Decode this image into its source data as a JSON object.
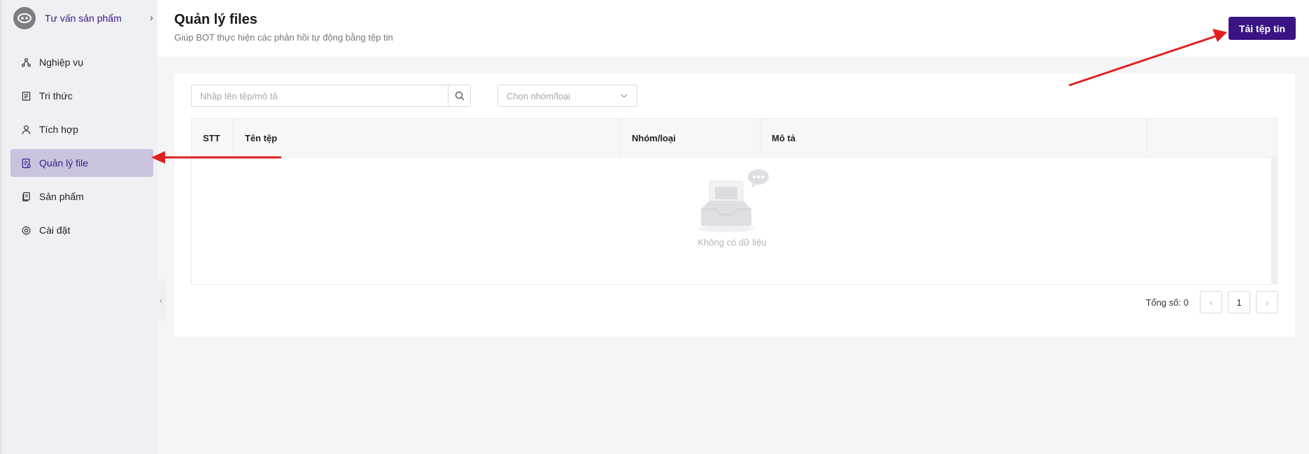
{
  "sidebar": {
    "bot_name": "Tư vấn sản phẩm",
    "items": [
      {
        "label": "Nghiệp vụ",
        "icon": "nodes-icon"
      },
      {
        "label": "Tri thức",
        "icon": "document-list-icon"
      },
      {
        "label": "Tích hợp",
        "icon": "user-icon"
      },
      {
        "label": "Quản lý file",
        "icon": "file-manage-icon",
        "active": true
      },
      {
        "label": "Sản phẩm",
        "icon": "product-icon"
      },
      {
        "label": "Cài đặt",
        "icon": "gear-icon"
      }
    ]
  },
  "header": {
    "title": "Quản lý files",
    "subtitle": "Giúp BOT thực hiện các phản hồi tự động bằng tệp tin",
    "upload_label": "Tải tệp tin"
  },
  "filters": {
    "search_placeholder": "Nhập tên tệp/mô tả",
    "group_placeholder": "Chọn nhóm/loại"
  },
  "table": {
    "columns": [
      "STT",
      "Tên tệp",
      "Nhóm/loại",
      "Mô tả",
      ""
    ],
    "empty_text": "Không có dữ liệu"
  },
  "pagination": {
    "total_label": "Tổng số: 0",
    "current_page": "1",
    "prev": "‹",
    "next": "›"
  },
  "colors": {
    "primary": "#3b1484",
    "active_menu_bg": "#cac3dd",
    "annotation_arrow": "#e02020"
  }
}
